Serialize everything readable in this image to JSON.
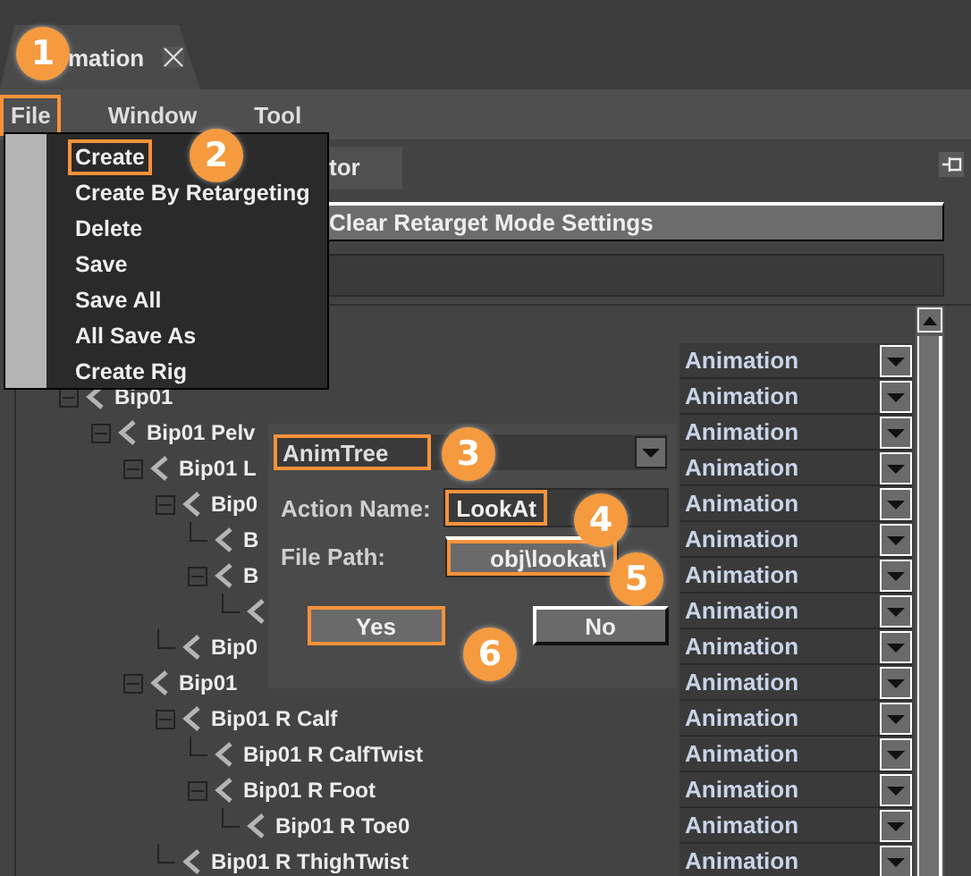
{
  "tab": {
    "label": "mation"
  },
  "menu_bar": [
    {
      "label": "File",
      "highlighted": true
    },
    {
      "label": "Window",
      "highlighted": false
    },
    {
      "label": "Tool",
      "highlighted": false
    }
  ],
  "file_menu": [
    {
      "label": "Create",
      "highlighted": true
    },
    {
      "label": "Create By Retargeting",
      "highlighted": false
    },
    {
      "label": "Delete",
      "highlighted": false
    },
    {
      "label": "Save",
      "highlighted": false
    },
    {
      "label": "Save All",
      "highlighted": false
    },
    {
      "label": "All Save As",
      "highlighted": false
    },
    {
      "label": "Create Rig",
      "highlighted": false
    }
  ],
  "panel_tab": {
    "label": "tor"
  },
  "clear_button": {
    "label": "Clear Retarget Mode Settings"
  },
  "tree": [
    {
      "mode": "Animation",
      "children": [
        {
          "label": "Bip01",
          "mode": "Animation",
          "expanded": true,
          "children": [
            {
              "label": "Bip01 Pelv",
              "mode": "Animation",
              "expanded": true,
              "children": [
                {
                  "label": "Bip01 L",
                  "mode": "Animation",
                  "expanded": true,
                  "children": [
                    {
                      "label": "Bip0",
                      "mode": "Animation",
                      "expanded": true,
                      "children": [
                        {
                          "label": "B",
                          "mode": "Animation"
                        },
                        {
                          "label": "B",
                          "mode": "Animation",
                          "expanded": true,
                          "children": [
                            {
                              "mode": "Animation"
                            }
                          ]
                        }
                      ]
                    },
                    {
                      "label": "Bip0",
                      "mode": "Animation"
                    }
                  ]
                },
                {
                  "label": "Bip01",
                  "mode": "Animation",
                  "expanded": true,
                  "children": [
                    {
                      "label": "Bip01 R Calf",
                      "mode": "Animation",
                      "expanded": true,
                      "children": [
                        {
                          "label": "Bip01 R CalfTwist",
                          "mode": "Animation"
                        },
                        {
                          "label": "Bip01 R Foot",
                          "mode": "Animation",
                          "expanded": true,
                          "children": [
                            {
                              "label": "Bip01 R Toe0",
                              "mode": "Animation"
                            }
                          ]
                        }
                      ]
                    },
                    {
                      "label": "Bip01 R ThighTwist",
                      "mode": "Animation"
                    }
                  ]
                }
              ]
            }
          ]
        }
      ]
    }
  ],
  "dialog": {
    "type": {
      "value": "AnimTree",
      "highlighted": true
    },
    "action_name": {
      "label": "Action Name:",
      "value": "LookAt",
      "highlighted": true
    },
    "file_path": {
      "label": "File Path:",
      "value": "obj\\lookat\\",
      "highlighted": true
    },
    "buttons": [
      {
        "label": "Yes",
        "highlighted": true
      },
      {
        "label": "No",
        "highlighted": false
      }
    ]
  },
  "callouts": [
    {
      "number": "1"
    },
    {
      "number": "2"
    },
    {
      "number": "3"
    },
    {
      "number": "4"
    },
    {
      "number": "5"
    },
    {
      "number": "6"
    }
  ]
}
